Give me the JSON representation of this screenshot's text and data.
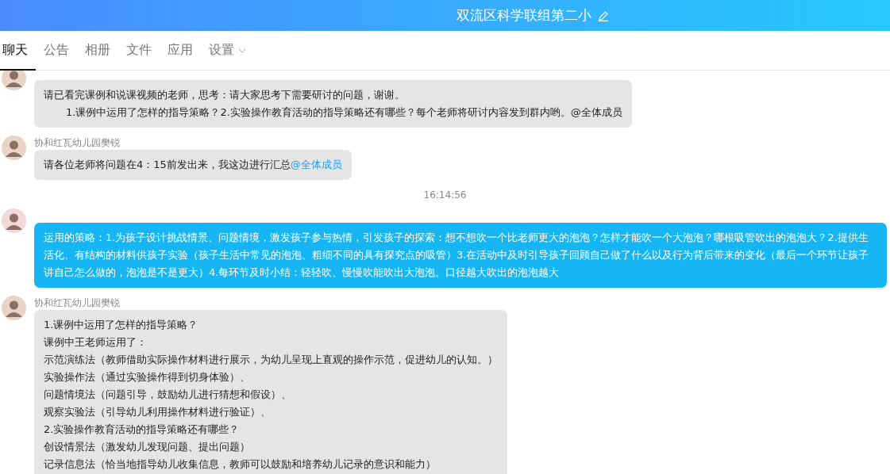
{
  "header": {
    "title": "双流区科学联组第二小"
  },
  "tabs": [
    {
      "label": "聊天",
      "selected": true,
      "dropdown": false
    },
    {
      "label": "公告",
      "selected": false,
      "dropdown": false
    },
    {
      "label": "相册",
      "selected": false,
      "dropdown": false
    },
    {
      "label": "文件",
      "selected": false,
      "dropdown": false
    },
    {
      "label": "应用",
      "selected": false,
      "dropdown": false
    },
    {
      "label": "设置",
      "selected": false,
      "dropdown": true
    }
  ],
  "chat": [
    {
      "kind": "message",
      "outgoing": false,
      "lines": [
        {
          "text": "请已看完课例和说课视频的老师，思考：请大家思考下需要研讨的问题，谢谢。",
          "indent": false
        },
        {
          "text": "1.课例中运用了怎样的指导策略？2.实验操作教育活动的指导策略还有哪些？每个老师将研讨内容发到群内哟。@全体成员",
          "indent": true
        }
      ]
    },
    {
      "kind": "message",
      "outgoing": false,
      "sender": "协和红瓦幼儿园樊锐",
      "lines": [
        {
          "text": "请各位老师将问题在4：15前发出来，我这边进行汇总",
          "indent": false
        }
      ],
      "mention": "@全体成员"
    },
    {
      "kind": "time",
      "text": "16:14:56"
    },
    {
      "kind": "message",
      "outgoing": true,
      "lines": [
        {
          "text": "运用的策略：1.为孩子设计挑战情景、问题情境，激发孩子参与热情，引发孩子的探索：想不想吹一个比老师更大的泡泡？怎样才能吹一个大泡泡？哪根吸管吹出的泡泡大？2.提供生活化、有结构的材料供孩子实验（孩子生活中常见的泡泡、粗细不同的具有探究点的吸管）3.在活动中及时引导孩子回顾自己做了什么以及行为背后带来的变化（最后一个环节让孩子讲自己怎么做的，泡泡是不是更大）4.每环节及时小结：轻轻吹、慢慢吹能吹出大泡泡。口径越大吹出的泡泡越大",
          "indent": false
        }
      ]
    },
    {
      "kind": "message",
      "outgoing": false,
      "sender": "协和红瓦幼儿园樊锐",
      "lines": [
        {
          "text": "1.课例中运用了怎样的指导策略？",
          "indent": false
        },
        {
          "text": "课例中王老师运用了：",
          "indent": false
        },
        {
          "text": "示范演练法（教师借助实际操作材料进行展示，为幼儿呈现上直观的操作示范，促进幼儿的认知。）",
          "indent": false
        },
        {
          "text": "实验操作法（通过实验操作得到切身体验）、",
          "indent": false
        },
        {
          "text": "问题情境法（问题引导，鼓励幼儿进行猜想和假设）、",
          "indent": false
        },
        {
          "text": "观察实验法（引导幼儿利用操作材料进行验证）、",
          "indent": false
        },
        {
          "text": "2.实验操作教育活动的指导策略还有哪些？",
          "indent": false
        },
        {
          "text": "创设情景法（激发幼儿发现问题、提出问题）",
          "indent": false
        },
        {
          "text": "记录信息法（恰当地指导幼儿收集信息，教师可以鼓励和培养幼儿记录的意识和能力）",
          "indent": false
        }
      ]
    }
  ]
}
